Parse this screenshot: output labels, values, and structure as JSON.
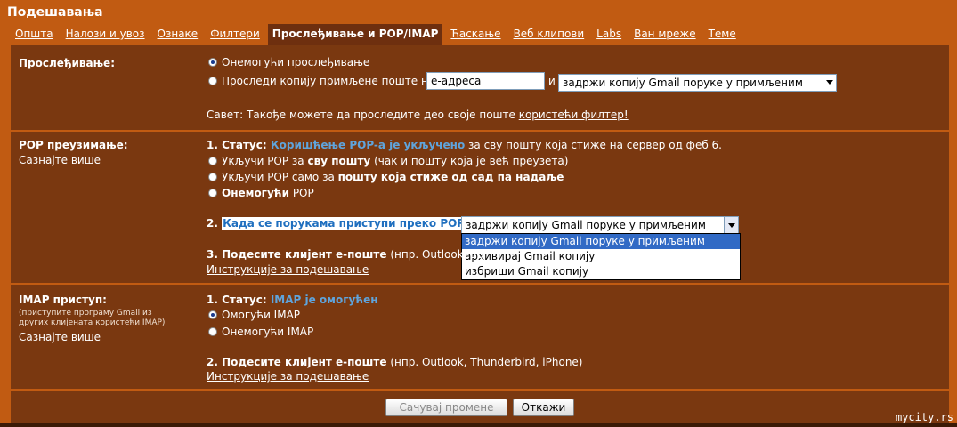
{
  "header": {
    "title": "Подешавања"
  },
  "tabs": [
    {
      "label": "Општа",
      "active": false
    },
    {
      "label": "Налози и увоз",
      "active": false
    },
    {
      "label": "Ознаке",
      "active": false
    },
    {
      "label": "Филтери",
      "active": false
    },
    {
      "label": "Прослеђивање и POP/IMAP",
      "active": true
    },
    {
      "label": "Ћаскање",
      "active": false
    },
    {
      "label": "Веб клипови",
      "active": false
    },
    {
      "label": "Labs",
      "active": false
    },
    {
      "label": "Ван мреже",
      "active": false
    },
    {
      "label": "Теме",
      "active": false
    }
  ],
  "forwarding": {
    "label": "Прослеђивање:",
    "option_disable": "Онемогући прослеђивање",
    "option_forward": "Проследи копију примљене поште на",
    "email_value": "е-адреса",
    "and": "и",
    "action_selected": "задржи копију Gmail поруке у примљеним",
    "tip": "Савет: Такође можете да проследите део своје поште ",
    "tip_link": "користећи филтер!"
  },
  "pop": {
    "label": "POP преузимање:",
    "learn_more": "Сазнајте више",
    "status_prefix": "1. Статус: ",
    "status_value": "Коришћење POP-а је укључено",
    "status_suffix": " за сву пошту која стиже на сервер од феб 6.",
    "opt1_pre": "Укључи POP за ",
    "opt1_bold": "сву пошту",
    "opt1_post": " (чак и пошту која је већ преузета)",
    "opt2_pre": "Укључи POP само за ",
    "opt2_bold": "пошту која стиже од сад па надаље",
    "opt3_bold": "Онемогући",
    "opt3_post": " POP",
    "when_prefix": "2. ",
    "when_text": "Када се порукама приступи преко POP-а",
    "when_selected": "задржи копију Gmail поруке у примљеним",
    "when_options": [
      "задржи копију Gmail поруке у примљеним",
      "архивирај Gmail копију",
      "избриши Gmail копију"
    ],
    "client_bold": "3. Подесите клијент е-поште",
    "client_rest": " (нпр. Outlook, Eu",
    "instructions": "Инструкције за подешавање"
  },
  "imap": {
    "label": "IMAP приступ:",
    "sub": "(приступите програму Gmail из других клијената користећи IMAP)",
    "learn_more": "Сазнајте више",
    "status_prefix": "1. Статус: ",
    "status_value": "IMAP је омогућен",
    "opt_enable": "Омогући IMAP",
    "opt_disable": "Онемогући IMAP",
    "client_bold": "2. Подесите клијент е-поште",
    "client_rest": " (нпр. Outlook, Thunderbird, iPhone)",
    "instructions": "Инструкције за подешавање"
  },
  "footer": {
    "save": "Сачувај промене",
    "cancel": "Откажи"
  },
  "watermark": "mycity.rs",
  "colors": {
    "orange": "#c15b12",
    "panel": "#7a3810",
    "accent_blue": "#5fa4dc"
  }
}
